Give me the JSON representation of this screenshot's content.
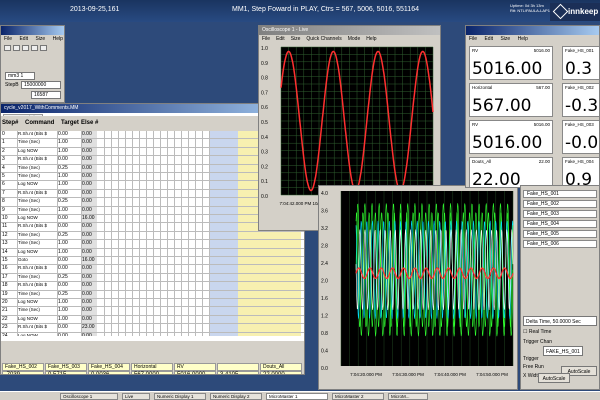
{
  "top": {
    "date": "2013-09-25,161",
    "title": "MM1, Step Foward in PLAY, Ctrs = 567, 5006, 5016, 551164",
    "uptime_lbl": "Uptime: 0d 3h 13m",
    "host": "Rtt: NTL/PAULA-LAP11",
    "logo": "innkeep"
  },
  "ctrl": {
    "title": "",
    "menu": [
      "File",
      "Edit",
      "Size",
      "Help"
    ],
    "name_val": "mm3 1",
    "step_lbl": "StepB",
    "step_val": "15000000",
    "count_val": "16587"
  },
  "seq": {
    "title": "cycle_v2017_WithComments.MM",
    "tab": "Type Description",
    "headers": {
      "step": "Step#",
      "command": "Command",
      "target": "Target",
      "else": "Else #"
    },
    "row0": {
      "n": "0",
      "cmd": "R.Sh.nt (Bits $",
      "tgt": "0.00",
      "el": "0.00"
    },
    "rows": [
      {
        "n": "1",
        "cmd": "Time (Sec)",
        "tgt": "1.00",
        "el": "0.00"
      },
      {
        "n": "2",
        "cmd": "Log NOW",
        "tgt": "1.00",
        "el": "0.00"
      },
      {
        "n": "3",
        "cmd": "R.Sh.nt (Bits $",
        "tgt": "0.00",
        "el": "0.00"
      },
      {
        "n": "4",
        "cmd": "Time (Sec)",
        "tgt": "0.25",
        "el": "0.00"
      },
      {
        "n": "5",
        "cmd": "Time (Sec)",
        "tgt": "1.00",
        "el": "0.00"
      },
      {
        "n": "6",
        "cmd": "Log NOW",
        "tgt": "1.00",
        "el": "0.00"
      },
      {
        "n": "7",
        "cmd": "R.Sh.nt (Bits $",
        "tgt": "0.00",
        "el": "0.00"
      },
      {
        "n": "8",
        "cmd": "Time (Sec)",
        "tgt": "0.25",
        "el": "0.00"
      },
      {
        "n": "9",
        "cmd": "Time (Sec)",
        "tgt": "1.00",
        "el": "0.00"
      },
      {
        "n": "10",
        "cmd": "Log NOW",
        "tgt": "0.00",
        "el": "16.00"
      },
      {
        "n": "11",
        "cmd": "R.Sh.nt (Bits $",
        "tgt": "0.00",
        "el": "0.00"
      },
      {
        "n": "12",
        "cmd": "Time (Sec)",
        "tgt": "0.25",
        "el": "0.00"
      },
      {
        "n": "13",
        "cmd": "Time (Sec)",
        "tgt": "1.00",
        "el": "0.00"
      },
      {
        "n": "14",
        "cmd": "Log NOW",
        "tgt": "1.00",
        "el": "0.00"
      },
      {
        "n": "15",
        "cmd": "Goto",
        "tgt": "0.00",
        "el": "16.00"
      },
      {
        "n": "16",
        "cmd": "R.Sh.nt (Bits $",
        "tgt": "0.00",
        "el": "0.00"
      },
      {
        "n": "17",
        "cmd": "Time (Sec)",
        "tgt": "0.25",
        "el": "0.00"
      },
      {
        "n": "18",
        "cmd": "R.Sh.nt (Bits $",
        "tgt": "0.00",
        "el": "0.00"
      },
      {
        "n": "19",
        "cmd": "Time (Sec)",
        "tgt": "0.25",
        "el": "0.00"
      },
      {
        "n": "20",
        "cmd": "Log NOW",
        "tgt": "1.00",
        "el": "0.00"
      },
      {
        "n": "21",
        "cmd": "Time (Sec)",
        "tgt": "1.00",
        "el": "0.00"
      },
      {
        "n": "22",
        "cmd": "Log NOW",
        "tgt": "1.00",
        "el": "0.00"
      },
      {
        "n": "23",
        "cmd": "R.Sh.nt (Bits $",
        "tgt": "0.00",
        "el": "23.00"
      },
      {
        "n": "24",
        "cmd": "Log NOW",
        "tgt": "0.00",
        "el": "0.00"
      }
    ],
    "channels": [
      {
        "name": "Fake_HS_002",
        "val": ".7039"
      },
      {
        "name": "Fake_HS_003",
        "val": "0.5715"
      },
      {
        "name": "Fake_HS_004",
        "val": "0.0036"
      },
      {
        "name": "Horizontal",
        "val": "567.0000"
      },
      {
        "name": "RV",
        "val": "5016.0000"
      },
      {
        "name": "",
        "val": "3.4105"
      },
      {
        "name": "Douts_All",
        "val": "22.0000"
      }
    ]
  },
  "osc1": {
    "title": "Oscilloscope 1 - Live",
    "menu": [
      "File",
      "Edit",
      "Size",
      "Quick Channels",
      "Mode",
      "Help"
    ],
    "y_ticks": [
      "1.0",
      "0.9",
      "0.8",
      "0.7",
      "0.6",
      "0.5",
      "0.4",
      "0.3",
      "0.2",
      "0.1",
      "0.0"
    ],
    "x_ticks": [
      "7:04:42.000 PM 10/2/2013",
      "7:04:48.000 PM 10/2/2013",
      "7:04:54.000 PM 10/2/2013"
    ]
  },
  "osc2": {
    "x_ticks": [
      "7:04:20.000 PM",
      "7:04:30.000 PM",
      "7:04:40.000 PM",
      "7:04:50.000 PM"
    ],
    "y_ticks": [
      "4.0",
      "3.6",
      "3.2",
      "2.8",
      "2.4",
      "2.0",
      "1.6",
      "1.2",
      "0.8",
      "0.4",
      "0.0"
    ]
  },
  "num": {
    "menu": [
      "File",
      "Edit",
      "Size",
      "Help"
    ],
    "boxes": [
      {
        "lbl": "RV",
        "rt": "5016.00",
        "big": "5016.00"
      },
      {
        "lbl": "Horizontal",
        "rt": "567.00",
        "big": "567.00"
      },
      {
        "lbl": "RV",
        "rt": "5016.00",
        "big": "5016.00"
      },
      {
        "lbl": "Douts_All",
        "rt": "22.00",
        "big": "22.00"
      }
    ],
    "boxes2": [
      {
        "lbl": "Fake_HS_001",
        "big": "0.3"
      },
      {
        "lbl": "Fake_HS_002",
        "big": "-0.3"
      },
      {
        "lbl": "Fake_HS_003",
        "big": "-0.0"
      },
      {
        "lbl": "Fake_HS_004",
        "big": "0.9"
      }
    ]
  },
  "side": {
    "items": [
      "Fake_HS_001",
      "Fake_HS_002",
      "Fake_HS_003",
      "Fake_HS_004",
      "Fake_HS_005",
      "Fake_HS_006"
    ],
    "delta": "Delta Time, 50.0000 Sec",
    "realtime": "Real Time",
    "trigger_chan": "Trigger Chan",
    "trig_val": "FAKE_HS_001",
    "trigger": "Trigger",
    "freerun": "Free Run",
    "xwidth": "X Width",
    "autoscale": "AutoScale",
    "autoscale2": "AutoScale"
  },
  "task": [
    "Oscilloscope 1",
    "Live",
    "Numeric Display 1",
    "Numeric Display 2",
    "MicroMaster 1",
    "MicroMaster 2",
    "MicroM..."
  ]
}
